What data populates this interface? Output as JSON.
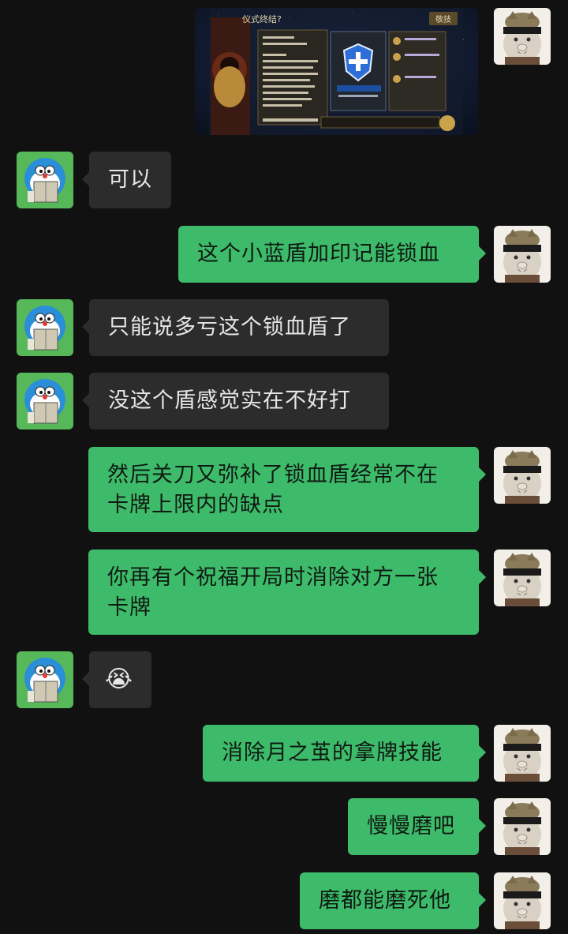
{
  "screenshot": {
    "title": "仪式终结?",
    "button_label": "敬技",
    "colors": {
      "night_sky": "#0d1526",
      "panel": "#2a2620",
      "gold": "#c9a24a",
      "shield_blue": "#2d6fd6"
    }
  },
  "messages": [
    {
      "id": 1,
      "side": "in",
      "text": "可以"
    },
    {
      "id": 2,
      "side": "out",
      "text": "这个小蓝盾加印记能锁血"
    },
    {
      "id": 3,
      "side": "in",
      "text": "只能说多亏这个锁血盾了"
    },
    {
      "id": 4,
      "side": "in",
      "text": "没这个盾感觉实在不好打"
    },
    {
      "id": 5,
      "side": "out",
      "text_line1": "然后关刀又弥补了锁血盾经常不在",
      "text_line2": "卡牌上限内的缺点"
    },
    {
      "id": 6,
      "side": "out",
      "text_line1": "你再有个祝福开局时消除对方一张",
      "text_line2": "卡牌"
    },
    {
      "id": 7,
      "side": "in",
      "emoji": "😭"
    },
    {
      "id": 8,
      "side": "out",
      "text": "消除月之茧的拿牌技能"
    },
    {
      "id": 9,
      "side": "out",
      "text": "慢慢磨吧"
    },
    {
      "id": 10,
      "side": "out",
      "text": "磨都能磨死他"
    }
  ],
  "avatars": {
    "left": "doraemon-reading-avatar",
    "right": "cat-with-headband-avatar"
  },
  "colors": {
    "background": "#111111",
    "incoming_bubble": "#2c2c2c",
    "outgoing_bubble": "#3dbb6a"
  }
}
